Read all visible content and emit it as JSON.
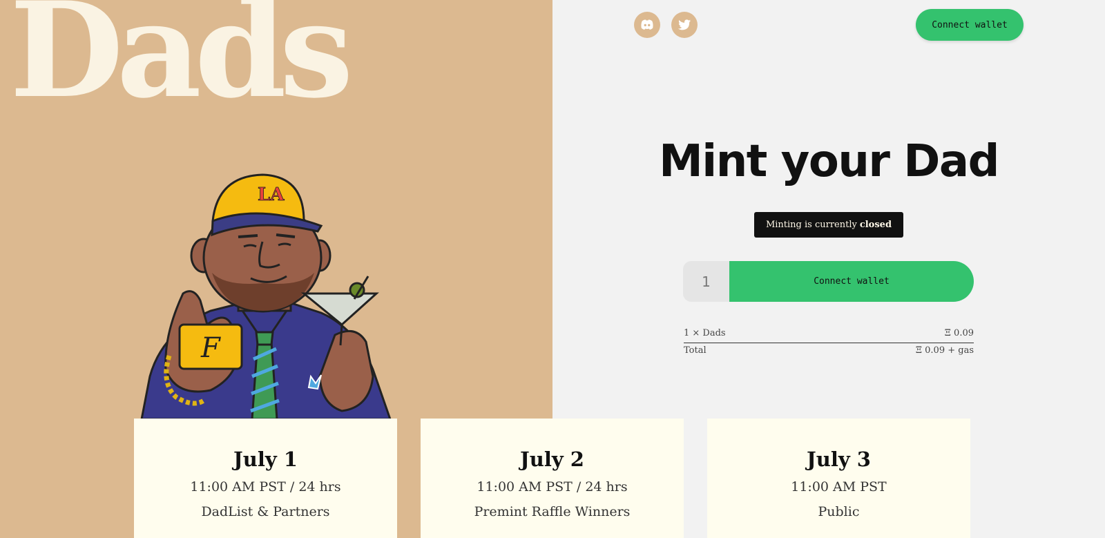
{
  "brand": {
    "logo_text": "Dads"
  },
  "header": {
    "social": [
      {
        "name": "discord-icon"
      },
      {
        "name": "twitter-icon"
      }
    ],
    "connect_wallet_label": "Connect wallet"
  },
  "mint": {
    "title": "Mint your Dad",
    "status_prefix": "Minting is currently",
    "status_value": "closed",
    "quantity_value": "1",
    "connect_wallet_label": "Connect wallet",
    "line_item_label": "1 × Dads",
    "line_item_price": "Ξ 0.09",
    "total_label": "Total",
    "total_value": "Ξ 0.09 + gas"
  },
  "schedule": [
    {
      "date": "July 1",
      "time": "11:00 AM PST / 24 hrs",
      "group": "DadList & Partners"
    },
    {
      "date": "July 2",
      "time": "11:00 AM PST / 24 hrs",
      "group": "Premint Raffle Winners"
    },
    {
      "date": "July 3",
      "time": "11:00 AM PST",
      "group": "Public"
    }
  ],
  "illustration": {
    "cap_text": "LA",
    "card_text": "F"
  },
  "colors": {
    "left_panel": "#dcb990",
    "right_panel": "#f2f2f2",
    "accent_green": "#34c26e",
    "logo_cream": "#faf3e3",
    "card_bg": "#fffdee"
  }
}
